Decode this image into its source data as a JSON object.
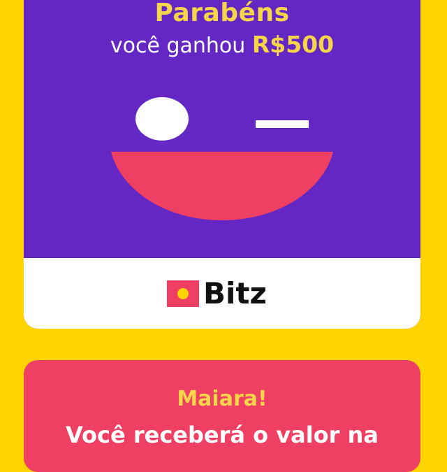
{
  "prize_card": {
    "title": "Parabéns",
    "subtitle_prefix": "você ganhou ",
    "amount": "R$500",
    "brand": {
      "name": "Bitz",
      "logo_icon": "bitz-logo-icon"
    },
    "illustration": "smiling-winking-face"
  },
  "message_card": {
    "recipient": "Maiara!",
    "text": "Você receberá o valor na"
  },
  "colors": {
    "background": "#FFD400",
    "card_purple": "#6527C3",
    "mouth_pink": "#EF3F62",
    "accent_yellow": "#F7D54A",
    "white": "#FFFFFF",
    "text_dark": "#111111"
  }
}
